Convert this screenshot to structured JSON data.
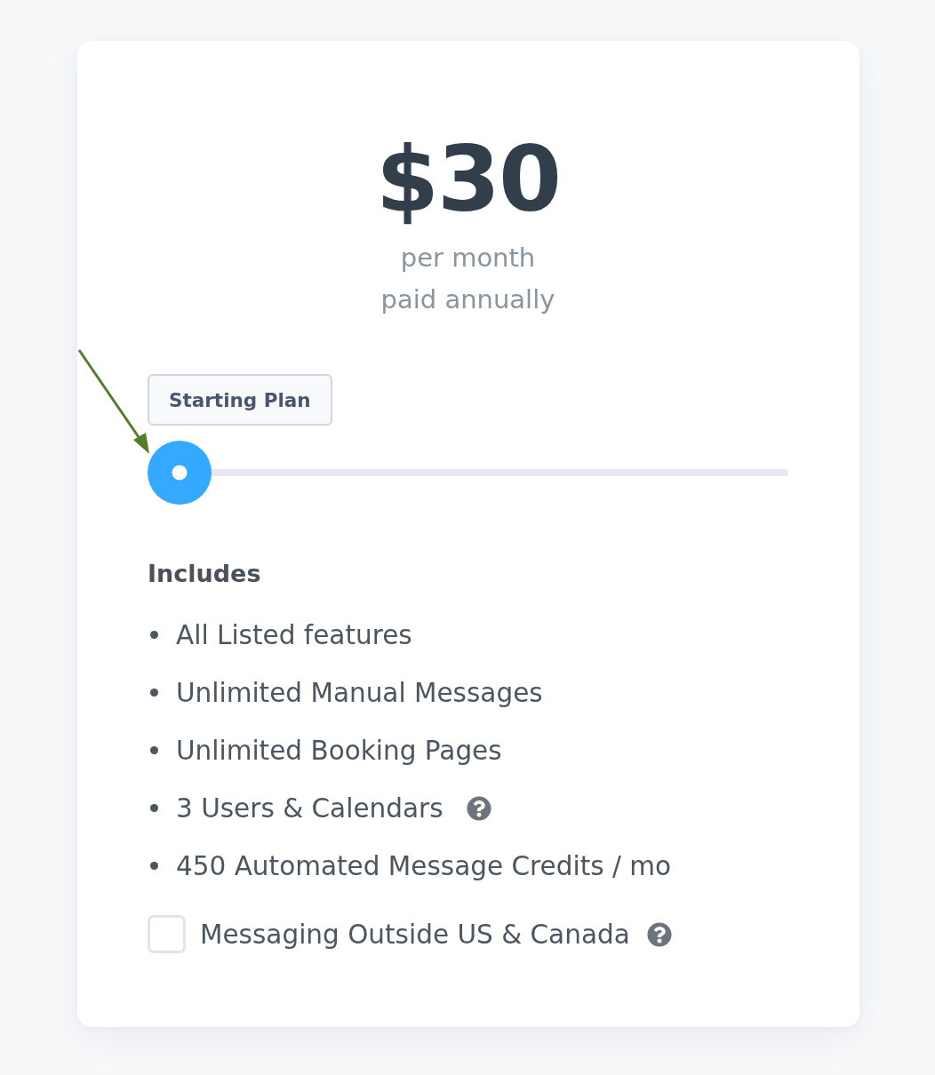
{
  "price": {
    "amount": "$30",
    "period": "per month",
    "billing": "paid annually"
  },
  "plan_slider": {
    "tooltip": "Starting Plan",
    "level": 0
  },
  "includes": {
    "heading": "Includes",
    "items": [
      {
        "text": "All Listed features",
        "help": false
      },
      {
        "text": "Unlimited Manual Messages",
        "help": false
      },
      {
        "text": "Unlimited Booking Pages",
        "help": false
      },
      {
        "text": "3 Users & Calendars",
        "help": true
      },
      {
        "text": "450 Automated Message Credits / mo",
        "help": false
      }
    ]
  },
  "addon": {
    "label": "Messaging Outside US & Canada",
    "checked": false,
    "help": true
  }
}
